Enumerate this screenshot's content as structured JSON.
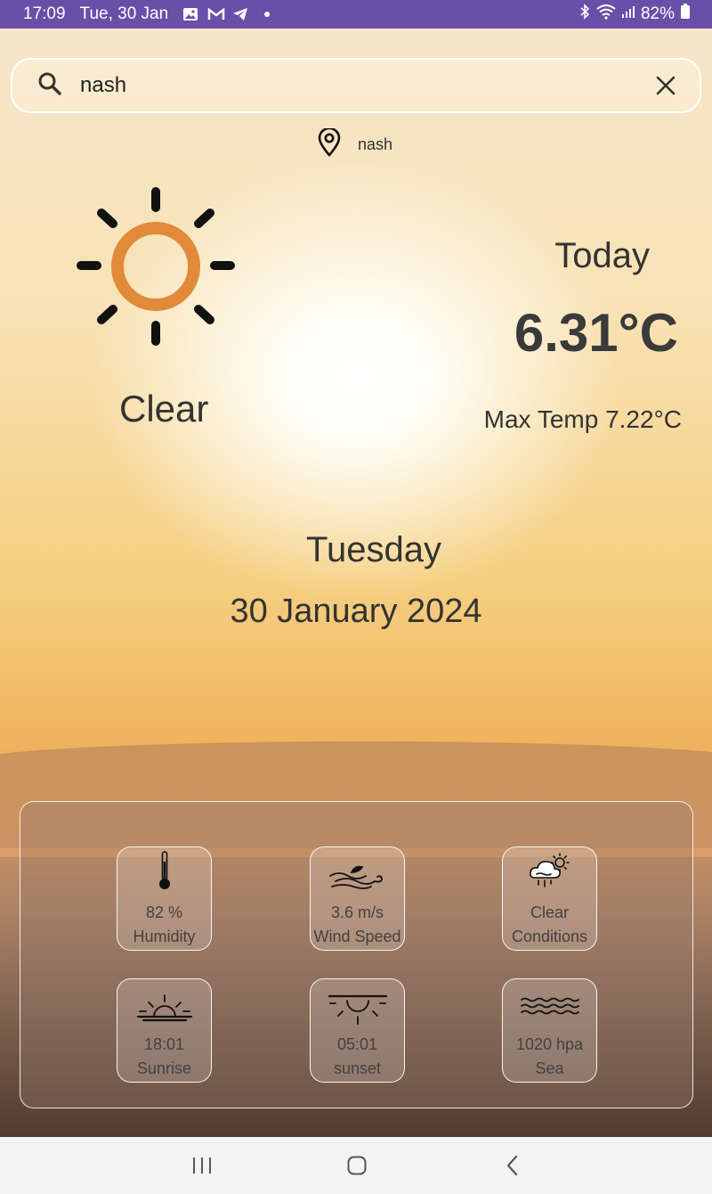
{
  "status_bar": {
    "time": "17:09",
    "date": "Tue, 30 Jan",
    "battery": "82%",
    "left_icons": [
      "gallery-icon",
      "gmail-icon",
      "telegram-icon",
      "dot-icon"
    ],
    "right_icons": [
      "bluetooth-icon",
      "wifi-icon",
      "signal-icon",
      "battery-icon"
    ]
  },
  "search": {
    "value": "nash",
    "icon": "search-icon",
    "clear_icon": "close-icon"
  },
  "location": {
    "name": "nash",
    "icon": "location-pin-icon"
  },
  "weather": {
    "condition": "Clear",
    "condition_icon": "sun-icon",
    "today_label": "Today",
    "temperature": "6.31°C",
    "max_temp": "Max Temp 7.22°C"
  },
  "date_info": {
    "weekday": "Tuesday",
    "date": "30 January 2024"
  },
  "details": [
    {
      "icon": "thermometer-icon",
      "value": "82 %",
      "label": "Humidity"
    },
    {
      "icon": "wind-icon",
      "value": "3.6 m/s",
      "label": "Wind Speed"
    },
    {
      "icon": "cloud-sun-rain-icon",
      "value": "Clear",
      "label": "Conditions"
    },
    {
      "icon": "sunrise-icon",
      "value": "18:01",
      "label": "Sunrise"
    },
    {
      "icon": "sunset-icon",
      "value": "05:01",
      "label": "sunset"
    },
    {
      "icon": "sea-waves-icon",
      "value": "1020 hpa",
      "label": "Sea"
    }
  ],
  "nav_bar": {
    "buttons": [
      "recent-apps-icon",
      "home-icon",
      "back-icon"
    ]
  },
  "colors": {
    "status_bar": "#6a4fa8",
    "sun": "#e08a3a"
  }
}
